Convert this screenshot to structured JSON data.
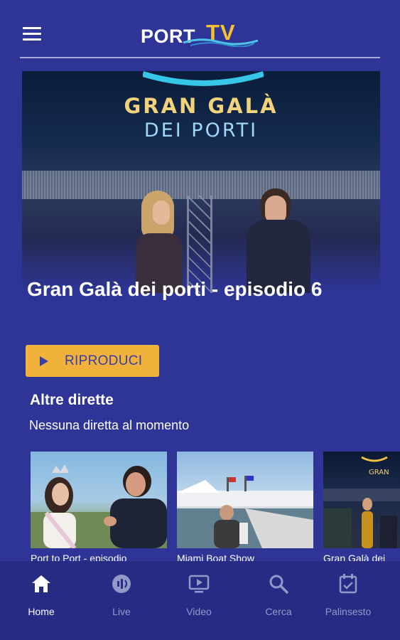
{
  "app": {
    "logo_text_port": "PORT",
    "logo_text_tv": "TV"
  },
  "hero": {
    "image_title_line1": "GRAN GALÀ",
    "image_title_line2": "DEI PORTI",
    "episode_title": "Gran Galà dei porti - episodio 6",
    "play_label": "RIPRODUCI"
  },
  "live_section": {
    "title": "Altre dirette",
    "subtitle": "Nessuna diretta al momento"
  },
  "carousel": {
    "items": [
      {
        "label": "Port to Port - episodio"
      },
      {
        "label": "Miami Boat Show"
      },
      {
        "label": "Gran Galà dei"
      }
    ]
  },
  "bottom_nav": {
    "items": [
      {
        "label": "Home",
        "icon": "home-icon",
        "active": true
      },
      {
        "label": "Live",
        "icon": "live-icon",
        "active": false
      },
      {
        "label": "Video",
        "icon": "video-icon",
        "active": false
      },
      {
        "label": "Cerca",
        "icon": "search-icon",
        "active": false
      },
      {
        "label": "Palinsesto",
        "icon": "calendar-icon",
        "active": false
      }
    ]
  },
  "colors": {
    "background": "#2e3597",
    "accent": "#f0b23a",
    "nav_background": "#262c84",
    "nav_inactive": "#9298c8"
  }
}
